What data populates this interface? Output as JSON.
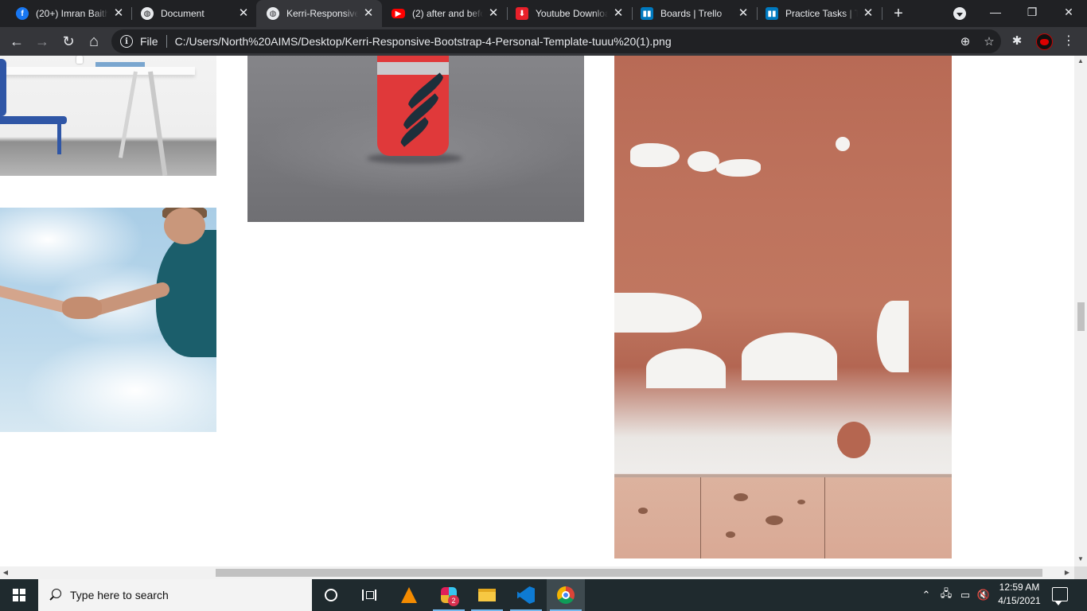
{
  "browser": {
    "tabs": [
      {
        "title": "(20+) Imran Baith",
        "icon": "facebook-icon",
        "active": false
      },
      {
        "title": "Document",
        "icon": "globe-icon",
        "active": false
      },
      {
        "title": "Kerri-Responsive",
        "icon": "globe-icon",
        "active": true
      },
      {
        "title": "(2) after and befo",
        "icon": "youtube-icon",
        "active": false
      },
      {
        "title": "Youtube Downloa",
        "icon": "download-icon",
        "active": false
      },
      {
        "title": "Boards | Trello",
        "icon": "trello-icon",
        "active": false
      },
      {
        "title": "Practice Tasks | Tr",
        "icon": "trello-icon",
        "active": false
      }
    ],
    "close_glyph": "✕",
    "new_tab_glyph": "+",
    "window_controls": {
      "minimize": "—",
      "restore": "❐",
      "close": "✕"
    },
    "toolbar": {
      "back": "←",
      "forward": "→",
      "reload": "↻",
      "home": "⌂",
      "scheme": "File",
      "url": "C:/Users/North%20AIMS/Desktop/Kerri-Responsive-Bootstrap-4-Personal-Template-tuuu%20(1).png",
      "info_glyph": "i",
      "zoom_glyph": "⊕",
      "star_glyph": "☆",
      "extensions_glyph": "✱",
      "menu_glyph": "⋮"
    }
  },
  "page": {
    "images": [
      {
        "name": "office-desk-photo",
        "description_icon": "photo"
      },
      {
        "name": "handshake-sky-photo",
        "description_icon": "photo"
      },
      {
        "name": "red-bottle-photo",
        "description_icon": "photo"
      },
      {
        "name": "terracotta-wall-photo",
        "description_icon": "photo"
      }
    ],
    "scroll_up": "▲",
    "scroll_down": "▼",
    "scroll_left": "◀",
    "scroll_right": "▶"
  },
  "taskbar": {
    "search_placeholder": "Type here to search",
    "slack_badge": "2",
    "time": "12:59 AM",
    "date": "4/15/2021",
    "tray": {
      "chevron": "⌃",
      "network": "🖧",
      "battery": "▭",
      "volume": "🔇"
    },
    "colors": {
      "bar": "#1f2a2e",
      "accent": "#76b9ed"
    }
  }
}
